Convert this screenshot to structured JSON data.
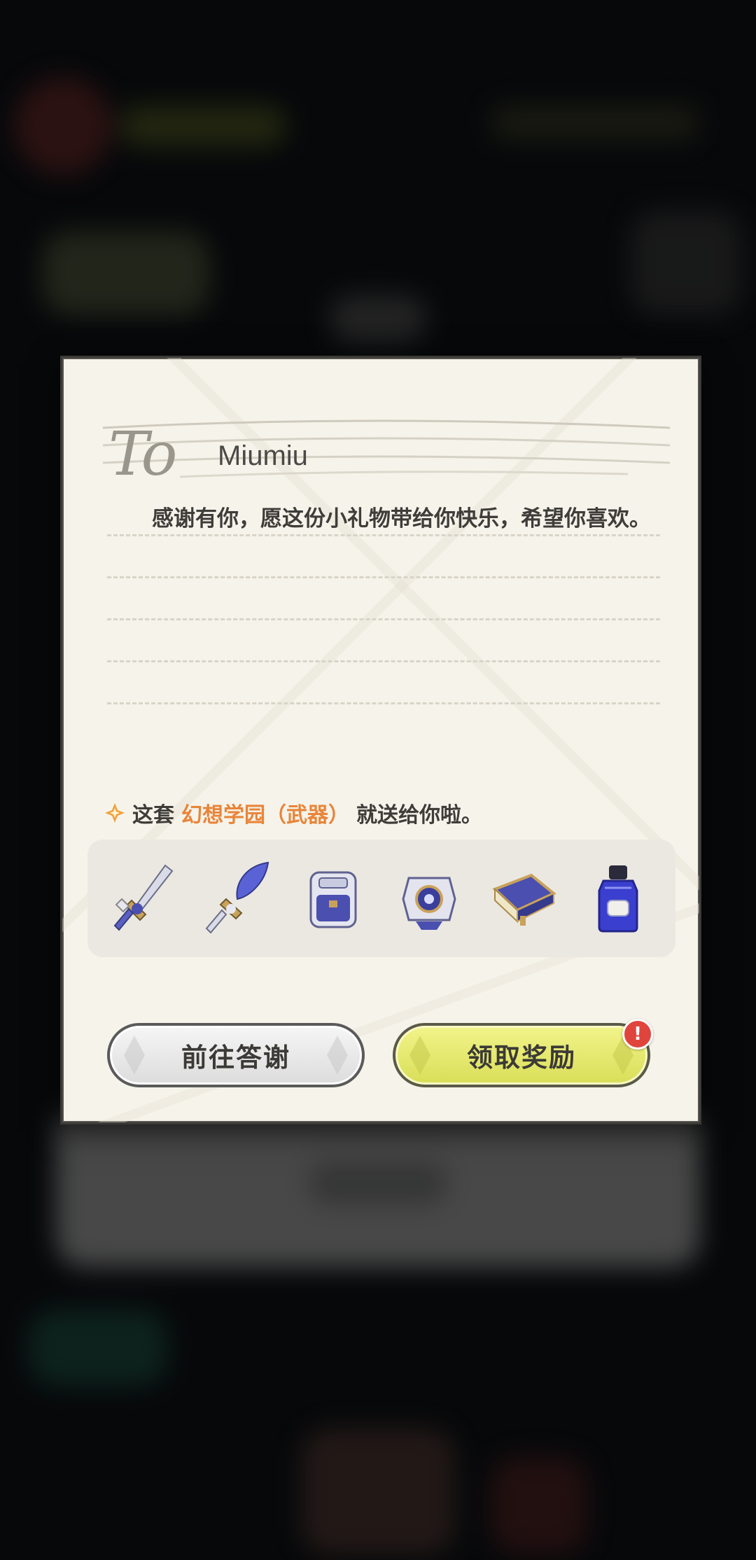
{
  "letter": {
    "to_script": "To",
    "recipient": "Miumiu",
    "message": "感谢有你，愿这份小礼物带给你快乐，希望你喜欢。",
    "gift_prefix": "这套",
    "gift_name": "幻想学园（武器）",
    "gift_suffix": "就送给你啦。"
  },
  "items": [
    {
      "name": "sword-icon"
    },
    {
      "name": "feather-sword-icon"
    },
    {
      "name": "backpack-icon"
    },
    {
      "name": "catalyst-orb-icon"
    },
    {
      "name": "book-icon"
    },
    {
      "name": "ink-bottle-icon"
    }
  ],
  "buttons": {
    "thanks_label": "前往答谢",
    "claim_label": "领取奖励",
    "badge": "!"
  },
  "colors": {
    "accent_orange": "#e8853a",
    "claim_button": "#e3e66a",
    "badge_red": "#e0453d"
  }
}
